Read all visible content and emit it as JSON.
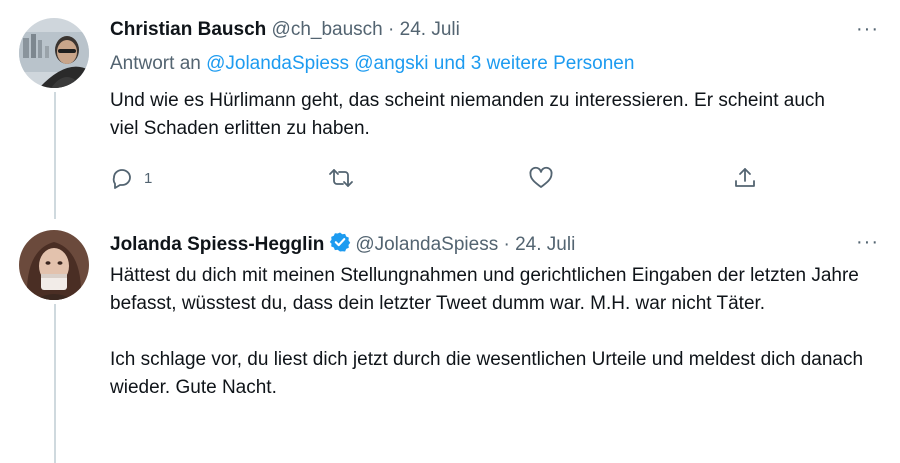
{
  "tweets": [
    {
      "author_name": "Christian Bausch",
      "handle": "@ch_bausch",
      "separator": "·",
      "date": "24. Juli",
      "reply_prefix": "Antwort an",
      "reply_targets": "@JolandaSpiess @angski und 3 weitere Personen",
      "text": "Und wie es Hürlimann geht, das scheint niemanden zu interessieren. Er scheint auch viel Schaden erlitten zu haben.",
      "more_label": "···",
      "actions": {
        "reply_count": "1",
        "reply_icon": "reply-icon",
        "retweet_icon": "retweet-icon",
        "like_icon": "heart-icon",
        "share_icon": "share-icon"
      }
    },
    {
      "author_name": "Jolanda Spiess-Hegglin",
      "verified_icon": "verified-badge-icon",
      "handle": "@JolandaSpiess",
      "separator": "·",
      "date": "24. Juli",
      "text": "Hättest du dich mit meinen Stellungnahmen und gerichtlichen Eingaben der letzten Jahre befasst, wüsstest du, dass dein letzter Tweet dumm war. M.H. war nicht Täter.\n\nIch schlage vor, du liest dich jetzt durch die wesentlichen Urteile und meldest dich danach wieder. Gute Nacht.",
      "more_label": "···"
    }
  ],
  "colors": {
    "text": "#0f1419",
    "secondary": "#536471",
    "link": "#1d9bf0",
    "thread_line": "#cfd9de"
  }
}
